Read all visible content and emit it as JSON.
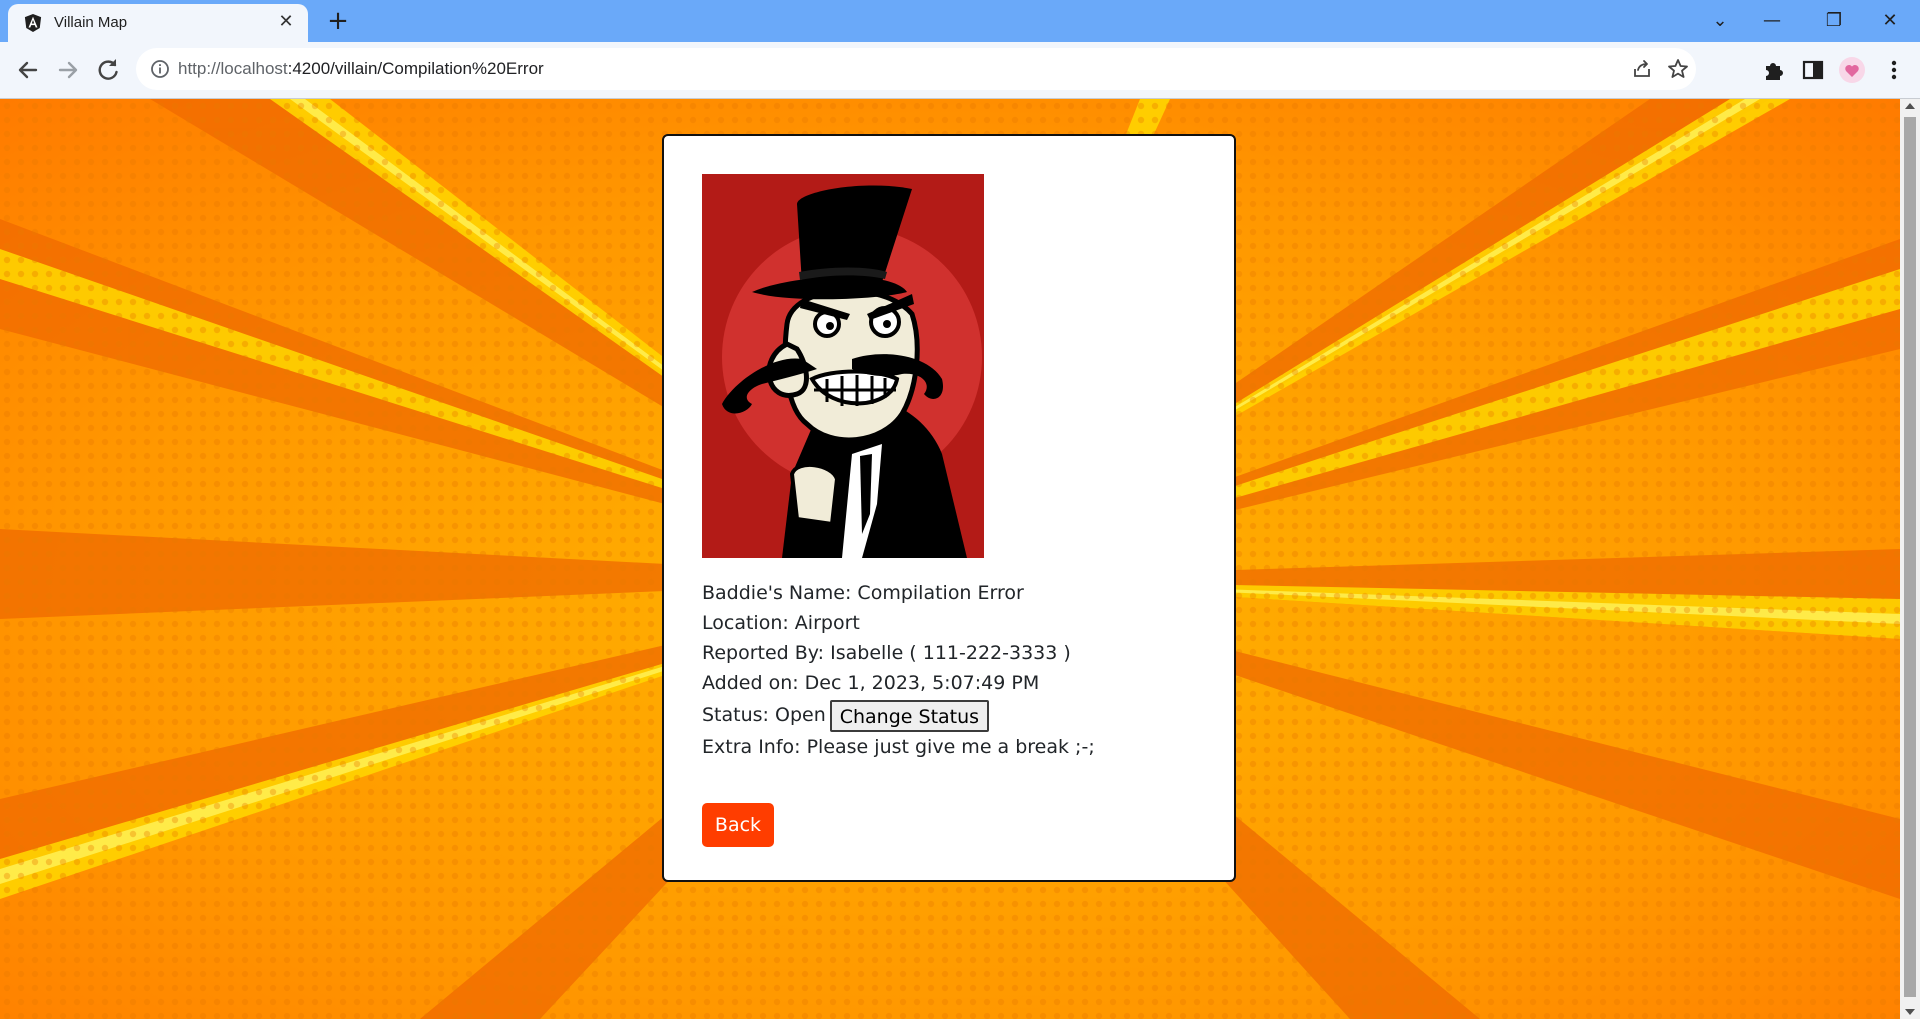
{
  "browser": {
    "tab_title": "Villain Map",
    "tab_close": "✕",
    "new_tab": "+",
    "url_host": "http://localhost",
    "url_rest": ":4200/villain/Compilation%20Error",
    "minimize": "—",
    "restore": "❐",
    "close": "✕",
    "tab_search": "⌄"
  },
  "villain": {
    "name_label": "Baddie's Name: Compilation Error",
    "location_label": "Location: Airport",
    "reported_label": "Reported By: Isabelle ( 111-222-3333 )",
    "added_label": "Added on: Dec 1, 2023, 5:07:49 PM",
    "status_label": "Status: Open",
    "change_status_button": "Change Status",
    "extra_info_label": "Extra Info: Please just give me a break ;-;",
    "back_button": "Back"
  },
  "colors": {
    "tabstrip": "#6aa9f9",
    "background_orange": "#ff9a00",
    "back_button": "#ff3d00",
    "image_background": "#b31b17"
  }
}
